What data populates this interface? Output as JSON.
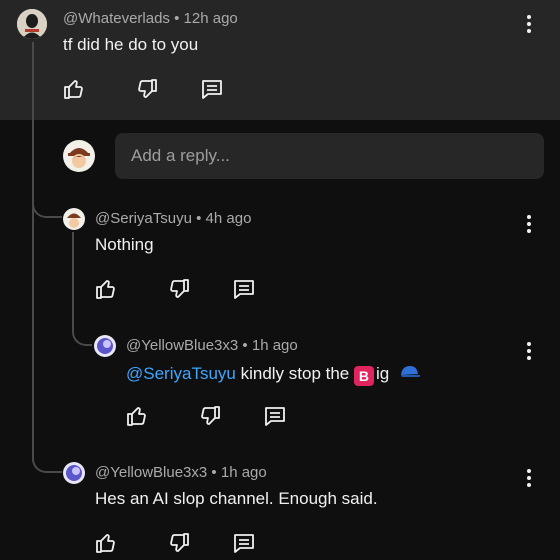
{
  "comments": {
    "top": {
      "author": "@Whateverlads",
      "time": "12h ago",
      "text": "tf did he do to you"
    },
    "reply_box": {
      "placeholder": "Add a reply..."
    },
    "reply1": {
      "author": "@SeriyaTsuyu",
      "time": "4h ago",
      "text": "Nothing"
    },
    "reply2": {
      "author": "@YellowBlue3x3",
      "time": "1h ago",
      "mention": "@SeriyaTsuyu",
      "text_a": " kindly stop the ",
      "badge": "B",
      "text_b": "ig"
    },
    "reply3": {
      "author": "@YellowBlue3x3",
      "time": "1h ago",
      "text": "Hes an AI slop channel. Enough said."
    }
  },
  "separator": "•",
  "icons": [
    "like-icon",
    "dislike-icon",
    "reply-icon",
    "more-vert-icon",
    "cap-emoji-icon"
  ],
  "colors": {
    "background": "#0f0f0f",
    "highlight": "#262626",
    "mention": "#3ea6ff",
    "meta": "#aaaaaa"
  }
}
